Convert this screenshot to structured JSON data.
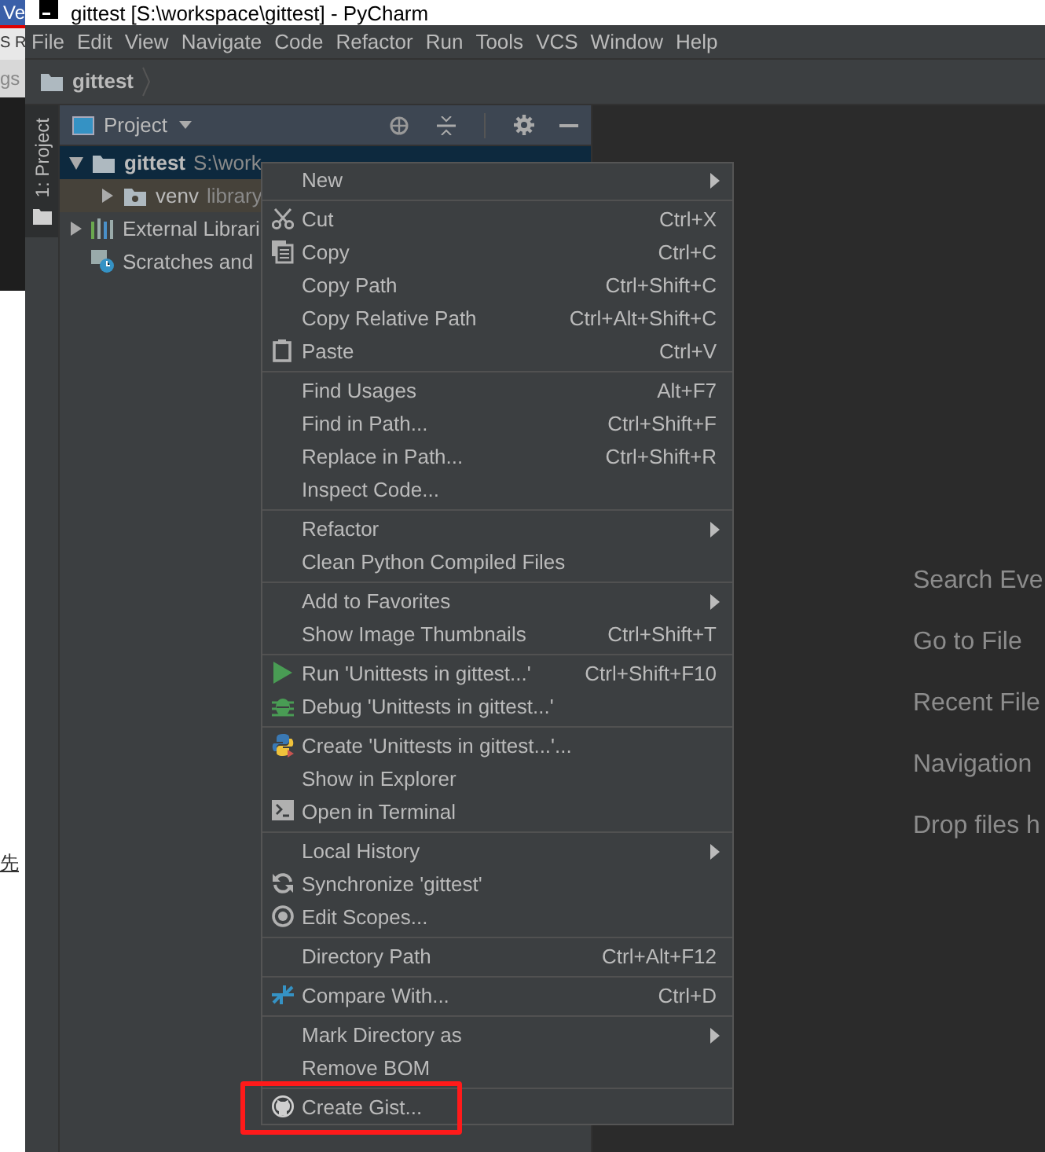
{
  "background_window": {
    "title_fragment": "Ve",
    "tab_fragment": "S R",
    "label_fragment": "gs",
    "text_fragment": "先"
  },
  "window": {
    "title": "gittest [S:\\workspace\\gittest] - PyCharm"
  },
  "menu_bar": [
    "File",
    "Edit",
    "View",
    "Navigate",
    "Code",
    "Refactor",
    "Run",
    "Tools",
    "VCS",
    "Window",
    "Help"
  ],
  "breadcrumb": "gittest",
  "tool_stripe": {
    "label": "1: Project",
    "selected": true
  },
  "project_panel": {
    "title": "Project",
    "tree": [
      {
        "label": "gittest",
        "detail": "S:\\work",
        "expanded": true,
        "selected": true,
        "children": [
          {
            "label": "venv",
            "detail": "library",
            "expanded": false,
            "selected": false,
            "excluded": true
          }
        ]
      },
      {
        "label": "External Librari",
        "expanded": false,
        "selected": false
      },
      {
        "label": "Scratches and",
        "selected": false
      }
    ]
  },
  "context_menu": [
    [
      {
        "label": "New",
        "submenu": true
      }
    ],
    [
      {
        "label": "Cut",
        "shortcut": "Ctrl+X"
      },
      {
        "label": "Copy",
        "shortcut": "Ctrl+C"
      },
      {
        "label": "Copy Path",
        "shortcut": "Ctrl+Shift+C"
      },
      {
        "label": "Copy Relative Path",
        "shortcut": "Ctrl+Alt+Shift+C"
      },
      {
        "label": "Paste",
        "shortcut": "Ctrl+V"
      }
    ],
    [
      {
        "label": "Find Usages",
        "shortcut": "Alt+F7"
      },
      {
        "label": "Find in Path...",
        "shortcut": "Ctrl+Shift+F"
      },
      {
        "label": "Replace in Path...",
        "shortcut": "Ctrl+Shift+R"
      },
      {
        "label": "Inspect Code..."
      }
    ],
    [
      {
        "label": "Refactor",
        "submenu": true
      },
      {
        "label": "Clean Python Compiled Files"
      }
    ],
    [
      {
        "label": "Add to Favorites",
        "submenu": true
      },
      {
        "label": "Show Image Thumbnails",
        "shortcut": "Ctrl+Shift+T"
      }
    ],
    [
      {
        "label": "Run 'Unittests in gittest...'",
        "shortcut": "Ctrl+Shift+F10"
      },
      {
        "label": "Debug 'Unittests in gittest...'"
      }
    ],
    [
      {
        "label": "Create 'Unittests in gittest...'..."
      },
      {
        "label": "Show in Explorer"
      },
      {
        "label": "Open in Terminal"
      }
    ],
    [
      {
        "label": "Local History",
        "submenu": true
      },
      {
        "label": "Synchronize 'gittest'"
      },
      {
        "label": "Edit Scopes..."
      }
    ],
    [
      {
        "label": "Directory Path",
        "shortcut": "Ctrl+Alt+F12"
      }
    ],
    [
      {
        "label": "Compare With...",
        "shortcut": "Ctrl+D"
      }
    ],
    [
      {
        "label": "Mark Directory as",
        "submenu": true
      },
      {
        "label": "Remove BOM"
      }
    ],
    [
      {
        "label": "Create Gist...",
        "highlighted_by_annotation": true
      }
    ]
  ],
  "editor_hints": [
    "Search Eve",
    "Go to File",
    "Recent File",
    "Navigation",
    "Drop files h"
  ]
}
